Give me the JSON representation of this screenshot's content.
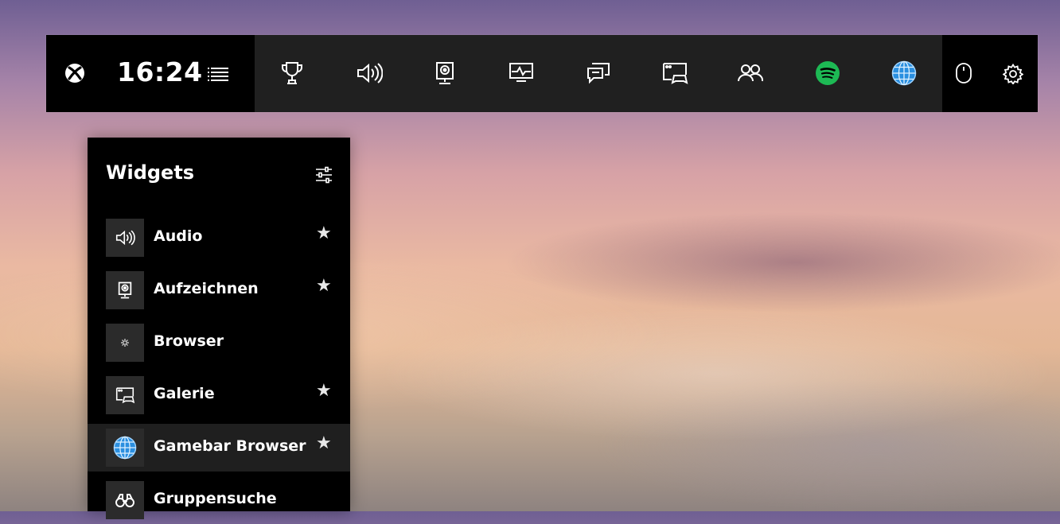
{
  "topbar": {
    "logo_icon": "xbox-logo-icon",
    "clock": "16:24",
    "menu_icon": "list-menu-icon",
    "widgets": [
      {
        "name": "achievements",
        "icon": "trophy-icon"
      },
      {
        "name": "audio",
        "icon": "speaker-icon"
      },
      {
        "name": "capture",
        "icon": "webcam-icon"
      },
      {
        "name": "performance",
        "icon": "monitor-graph-icon"
      },
      {
        "name": "chat",
        "icon": "chat-bubbles-icon"
      },
      {
        "name": "gallery",
        "icon": "gallery-controller-icon"
      },
      {
        "name": "social",
        "icon": "people-icon"
      },
      {
        "name": "spotify",
        "icon": "spotify-icon"
      },
      {
        "name": "gamebar-browser",
        "icon": "globe-icon"
      }
    ],
    "right_icons": [
      "mouse-icon",
      "gear-icon"
    ]
  },
  "panel": {
    "title": "Widgets",
    "settings_icon": "sliders-icon",
    "items": [
      {
        "label": "Audio",
        "icon": "speaker-icon",
        "favorite": true
      },
      {
        "label": "Aufzeichnen",
        "icon": "webcam-icon",
        "favorite": true
      },
      {
        "label": "Browser",
        "icon": "small-gear-icon",
        "favorite": false
      },
      {
        "label": "Galerie",
        "icon": "gallery-controller-icon",
        "favorite": true
      },
      {
        "label": "Gamebar Browser",
        "icon": "globe-icon",
        "favorite": true
      },
      {
        "label": "Gruppensuche",
        "icon": "binoculars-icon",
        "favorite": false
      }
    ],
    "star_glyph": "★"
  },
  "colors": {
    "bar_bg": "#202020",
    "panel_bg": "#000000",
    "spotify": "#1DB954",
    "globe": "#2a8fe0"
  }
}
